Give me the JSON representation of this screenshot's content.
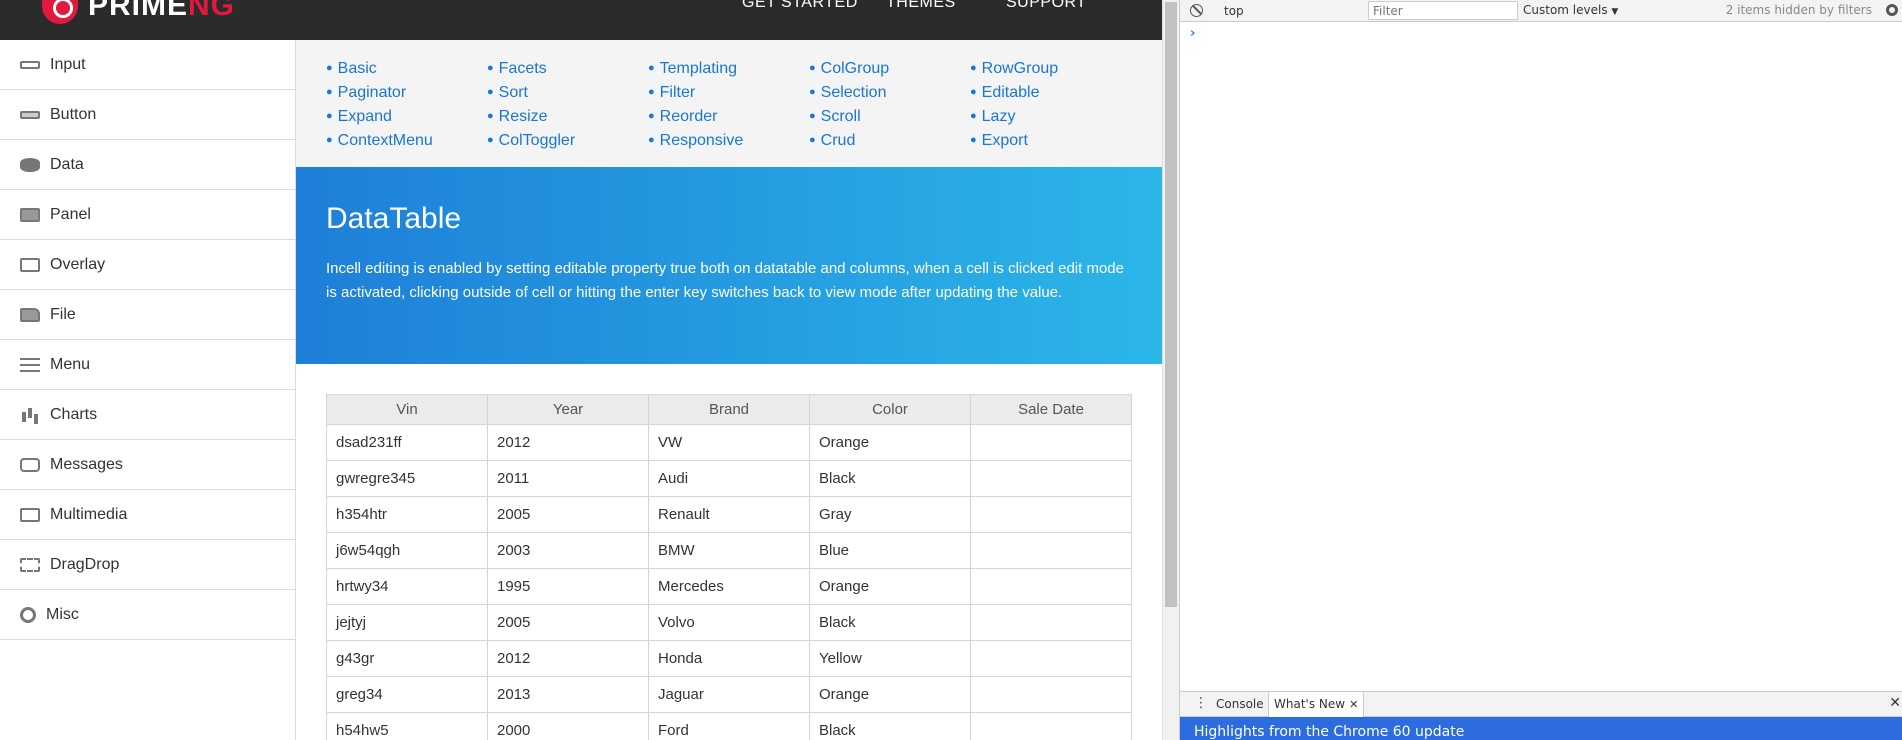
{
  "logo": {
    "text_main": "PRIME",
    "text_accent": "NG"
  },
  "topnav": {
    "items": [
      "GET STARTED",
      "THEMES",
      "SUPPORT"
    ]
  },
  "sidebar": {
    "items": [
      {
        "label": "Input",
        "icon": "input-icon"
      },
      {
        "label": "Button",
        "icon": "button-icon"
      },
      {
        "label": "Data",
        "icon": "database-icon"
      },
      {
        "label": "Panel",
        "icon": "panel-icon"
      },
      {
        "label": "Overlay",
        "icon": "overlay-icon"
      },
      {
        "label": "File",
        "icon": "folder-icon"
      },
      {
        "label": "Menu",
        "icon": "menu-icon"
      },
      {
        "label": "Charts",
        "icon": "bar-chart-icon"
      },
      {
        "label": "Messages",
        "icon": "message-bubble-icon"
      },
      {
        "label": "Multimedia",
        "icon": "multimedia-icon"
      },
      {
        "label": "DragDrop",
        "icon": "drag-drop-icon"
      },
      {
        "label": "Misc",
        "icon": "gear-icon"
      }
    ]
  },
  "features": {
    "links": [
      [
        "Basic",
        "Paginator",
        "Expand",
        "ContextMenu"
      ],
      [
        "Facets",
        "Sort",
        "Resize",
        "ColToggler"
      ],
      [
        "Templating",
        "Filter",
        "Reorder",
        "Responsive"
      ],
      [
        "ColGroup",
        "Selection",
        "Scroll",
        "Crud"
      ],
      [
        "RowGroup",
        "Editable",
        "Lazy",
        "Export"
      ]
    ]
  },
  "hero": {
    "title": "DataTable",
    "description": "Incell editing is enabled by setting editable property true both on datatable and columns, when a cell is clicked edit mode is activated, clicking outside of cell or hitting the enter key switches back to view mode after updating the value."
  },
  "table": {
    "columns": [
      "Vin",
      "Year",
      "Brand",
      "Color",
      "Sale Date"
    ],
    "rows": [
      [
        "dsad231ff",
        "2012",
        "VW",
        "Orange",
        ""
      ],
      [
        "gwregre345",
        "2011",
        "Audi",
        "Black",
        ""
      ],
      [
        "h354htr",
        "2005",
        "Renault",
        "Gray",
        ""
      ],
      [
        "j6w54qgh",
        "2003",
        "BMW",
        "Blue",
        ""
      ],
      [
        "hrtwy34",
        "1995",
        "Mercedes",
        "Orange",
        ""
      ],
      [
        "jejtyj",
        "2005",
        "Volvo",
        "Black",
        ""
      ],
      [
        "g43gr",
        "2012",
        "Honda",
        "Yellow",
        ""
      ],
      [
        "greg34",
        "2013",
        "Jaguar",
        "Orange",
        ""
      ],
      [
        "h54hw5",
        "2000",
        "Ford",
        "Black",
        ""
      ]
    ]
  },
  "devtools": {
    "context": "top",
    "filter_placeholder": "Filter",
    "levels": "Custom levels",
    "hidden_info": "2 items hidden by filters",
    "prompt": "›",
    "drawer_tabs": [
      "Console",
      "What's New"
    ],
    "banner": "Highlights from the Chrome 60 update"
  },
  "colors": {
    "accent": "#1976d2",
    "brand": "#e2183f",
    "hero_start": "#1e7fd8",
    "hero_end": "#2bb6e8"
  }
}
